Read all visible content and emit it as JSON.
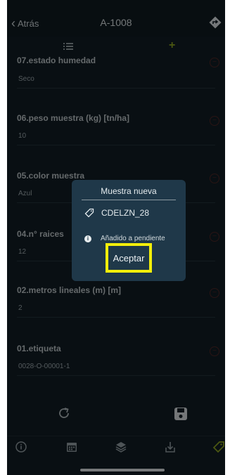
{
  "header": {
    "back_label": "Atrás",
    "title": "A-1008"
  },
  "fields": [
    {
      "label": "07.estado humedad",
      "value": "Seco"
    },
    {
      "label": "06.peso muestra (kg) [tn/ha]",
      "value": "10"
    },
    {
      "label": "05.color muestra",
      "value": "Azul"
    },
    {
      "label": "04.n° raices",
      "value": "12"
    },
    {
      "label": "02.metros lineales (m) [m]",
      "value": "2"
    },
    {
      "label": "01.etiqueta",
      "value": "0028-O-00001-1"
    }
  ],
  "modal": {
    "title": "Muestra nueva",
    "sample_code": "CDELZN_28",
    "status_text": "Añadido a pendiente",
    "accept_label": "Aceptar"
  },
  "colors": {
    "accent": "#8aa11f",
    "highlight": "#f2ee0a",
    "modal_bg": "#1f3849",
    "danger": "#4e2525"
  }
}
